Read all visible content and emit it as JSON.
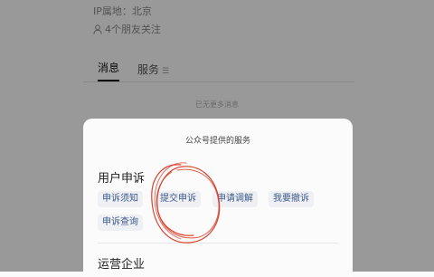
{
  "profile": {
    "ip_label": "IP属地：北京",
    "friends_label": "4个朋友关注",
    "friends_icon": "person-icon"
  },
  "tabs": [
    {
      "label": "消息",
      "active": true
    },
    {
      "label": "服务",
      "active": false
    }
  ],
  "messages": {
    "empty_text": "已无更多消息"
  },
  "sheet": {
    "title": "公众号提供的服务",
    "sections": [
      {
        "title": "用户申诉",
        "items": [
          "申诉须知",
          "提交申诉",
          "申请调解",
          "我要撤诉",
          "申诉查询"
        ]
      },
      {
        "title": "运营企业",
        "items": []
      }
    ]
  },
  "colors": {
    "chip_text": "#3e5a8c",
    "chip_bg": "#eef0f4",
    "annotation_red": "#d9432f"
  }
}
